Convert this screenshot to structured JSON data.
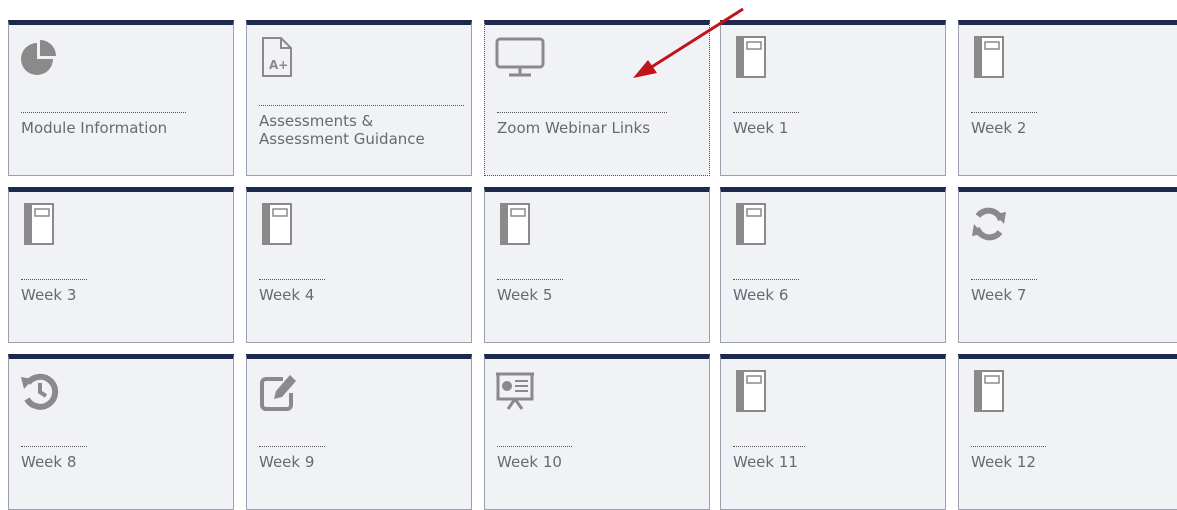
{
  "tiles": [
    {
      "label": "Module Information",
      "icon": "pie-chart-icon"
    },
    {
      "label": "Assessments & Assessment Guidance",
      "icon": "a-plus-document-icon"
    },
    {
      "label": "Zoom Webinar Links",
      "icon": "monitor-icon"
    },
    {
      "label": "Week 1",
      "icon": "notebook-icon"
    },
    {
      "label": "Week 2",
      "icon": "notebook-icon"
    },
    {
      "label": "Week 3",
      "icon": "notebook-icon"
    },
    {
      "label": "Week 4",
      "icon": "notebook-icon"
    },
    {
      "label": "Week 5",
      "icon": "notebook-icon"
    },
    {
      "label": "Week 6",
      "icon": "notebook-icon"
    },
    {
      "label": "Week 7",
      "icon": "refresh-icon"
    },
    {
      "label": "Week 8",
      "icon": "history-icon"
    },
    {
      "label": "Week 9",
      "icon": "edit-icon"
    },
    {
      "label": "Week 10",
      "icon": "presentation-icon"
    },
    {
      "label": "Week 11",
      "icon": "notebook-icon"
    },
    {
      "label": "Week 12",
      "icon": "notebook-icon"
    }
  ],
  "colors": {
    "tile_background": "#f1f2f6",
    "tile_top_border": "#1d2a4d",
    "icon_gray": "#8a8a8a",
    "label_text": "#666a73",
    "annotation_arrow": "#c0141b"
  }
}
